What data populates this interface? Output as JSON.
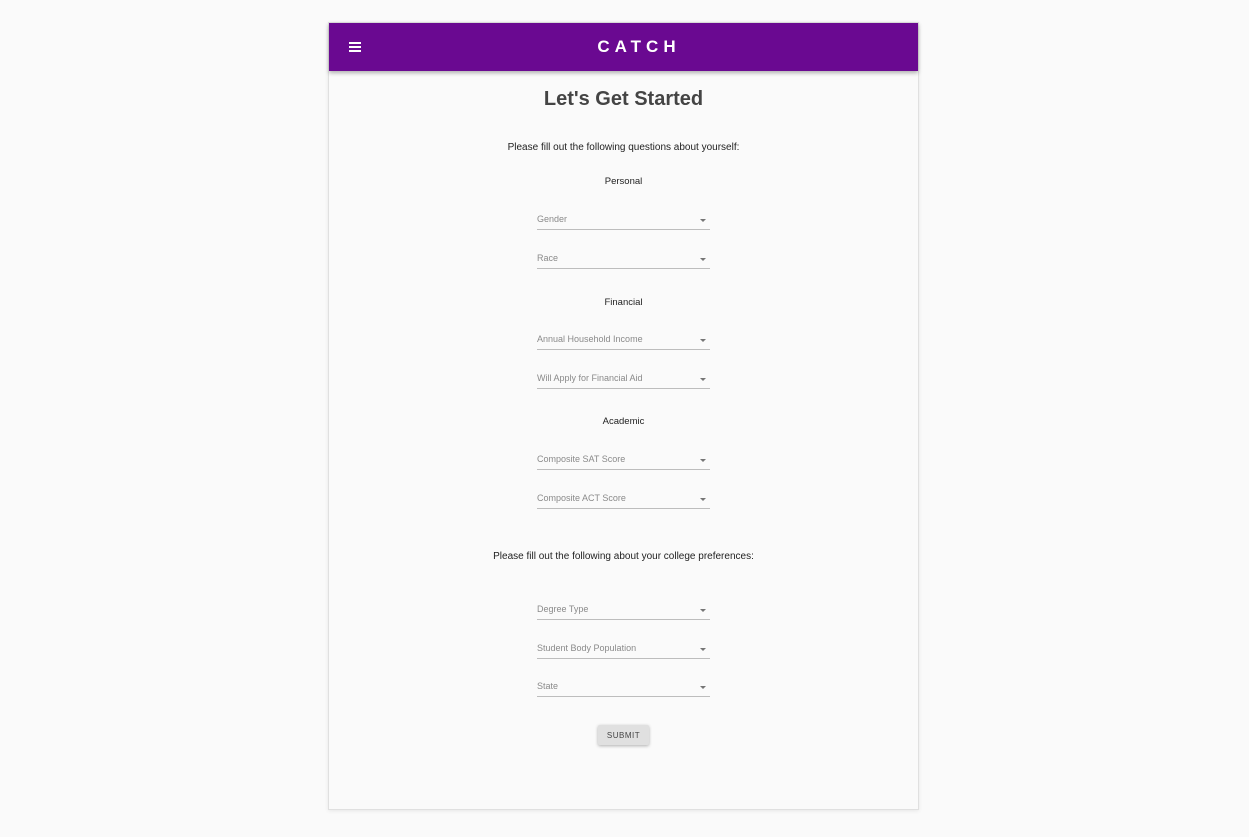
{
  "app": {
    "title": "CATCH",
    "menu_icon": "hamburger-menu-icon"
  },
  "page": {
    "heading": "Let's Get Started",
    "intro_about_yourself": "Please fill out the following questions about yourself:",
    "intro_college_prefs": "Please fill out the following about your college preferences:"
  },
  "sections": {
    "personal": "Personal",
    "financial": "Financial",
    "academic": "Academic"
  },
  "fields": {
    "gender": "Gender",
    "race": "Race",
    "income": "Annual Household Income",
    "financial_aid": "Will Apply for Financial Aid",
    "sat": "Composite SAT Score",
    "act": "Composite ACT Score",
    "degree_type": "Degree Type",
    "population": "Student Body Population",
    "state": "State"
  },
  "actions": {
    "submit": "SUBMIT"
  },
  "colors": {
    "brand": "#6a0991",
    "background": "#fafafa"
  }
}
